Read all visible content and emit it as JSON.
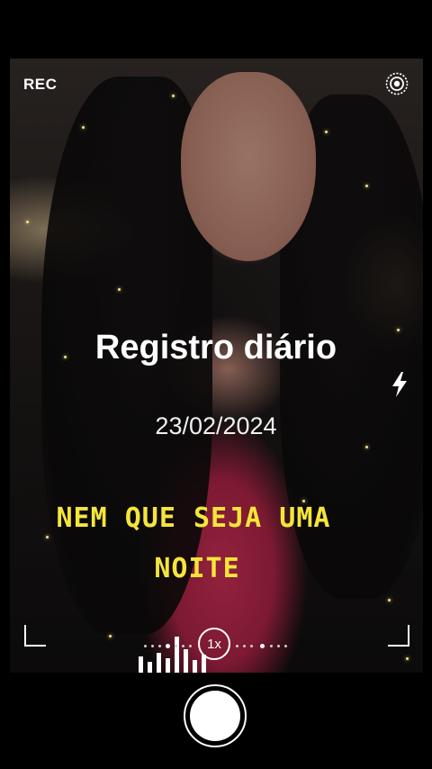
{
  "status": {
    "rec_label": "REC"
  },
  "overlay": {
    "title": "Registro diário",
    "date": "23/02/2024",
    "caption_line1": "NEM QUE SEJA UMA",
    "caption_line2": "NOITE"
  },
  "controls": {
    "zoom_label": "1x",
    "camera_mode_icon": "lens-target-icon",
    "flash_icon": "flash-icon",
    "shutter_icon": "shutter-button"
  },
  "colors": {
    "caption": "#f5e53a",
    "background": "#000000",
    "text": "#ffffff"
  }
}
